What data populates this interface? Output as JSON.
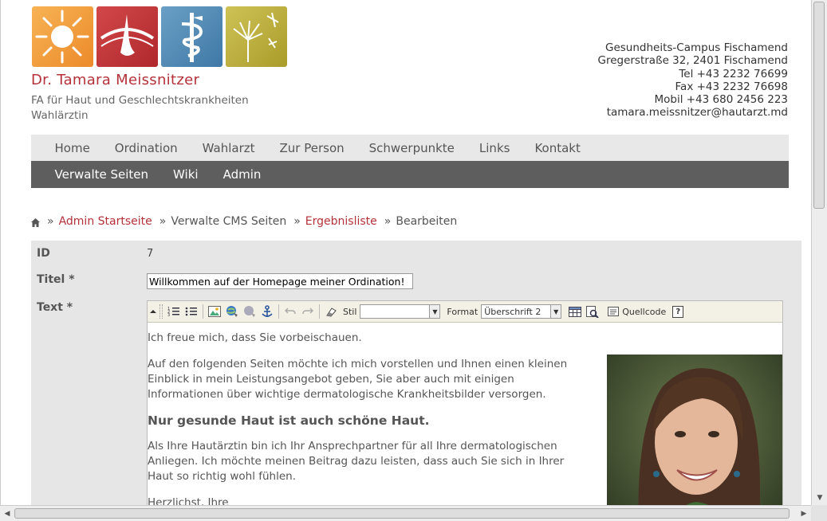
{
  "header": {
    "doctor_name": "Dr. Tamara Meissnitzer",
    "subtitle_line1": "FA für Haut und Geschlechtskrankheiten",
    "subtitle_line2": "Wahlärztin",
    "logos": [
      "sun-logo",
      "skin-logo",
      "medical-staff-logo",
      "dandelion-logo"
    ]
  },
  "contact": {
    "line1": "Gesundheits-Campus Fischamend",
    "line2": "Gregerstraße 32, 2401 Fischamend",
    "tel": "Tel +43 2232 76699",
    "fax": "Fax +43 2232 76698",
    "mobil": "Mobil +43 680 2456 223",
    "email": "tamara.meissnitzer@hautarzt.md"
  },
  "nav_main": [
    "Home",
    "Ordination",
    "Wahlarzt",
    "Zur Person",
    "Schwerpunkte",
    "Links",
    "Kontakt"
  ],
  "nav_admin": [
    "Verwalte Seiten",
    "Wiki",
    "Admin"
  ],
  "breadcrumb": {
    "sep": "»",
    "item1": "Admin Startseite",
    "item2": "Verwalte CMS Seiten",
    "item3": "Ergebnisliste",
    "item4": "Bearbeiten"
  },
  "form": {
    "id_label": "ID",
    "id_value": "7",
    "title_label": "Titel *",
    "title_value": "Willkommen auf der Homepage meiner Ordination!",
    "text_label": "Text *"
  },
  "editor": {
    "style_label": "Stil",
    "style_value": "",
    "format_label": "Format",
    "format_value": "Überschrift 2",
    "source_label": "Quellcode",
    "help_label": "?",
    "p1": "Ich freue mich, dass Sie vorbeischauen.",
    "p2": "Auf den folgenden Seiten möchte ich mich vorstellen und Ihnen einen kleinen Einblick in mein Leistungsangebot geben, Sie aber auch mit einigen Informationen über wichtige dermatologische Krankheitsbilder versorgen.",
    "heading": "Nur gesunde Haut ist auch schöne Haut.",
    "p3": "Als Ihre Hautärztin bin ich Ihr Ansprechpartner für all Ihre dermatologischen Anliegen. Ich möchte meinen Beitrag dazu leisten, dass auch Sie sich in Ihrer Haut so richtig wohl fühlen.",
    "p4": "Herzlichst, Ihre"
  },
  "colors": {
    "accent": "#b5313a",
    "nav_admin_bg": "#5e5e5e",
    "nav_main_bg": "#e8e8e8"
  }
}
